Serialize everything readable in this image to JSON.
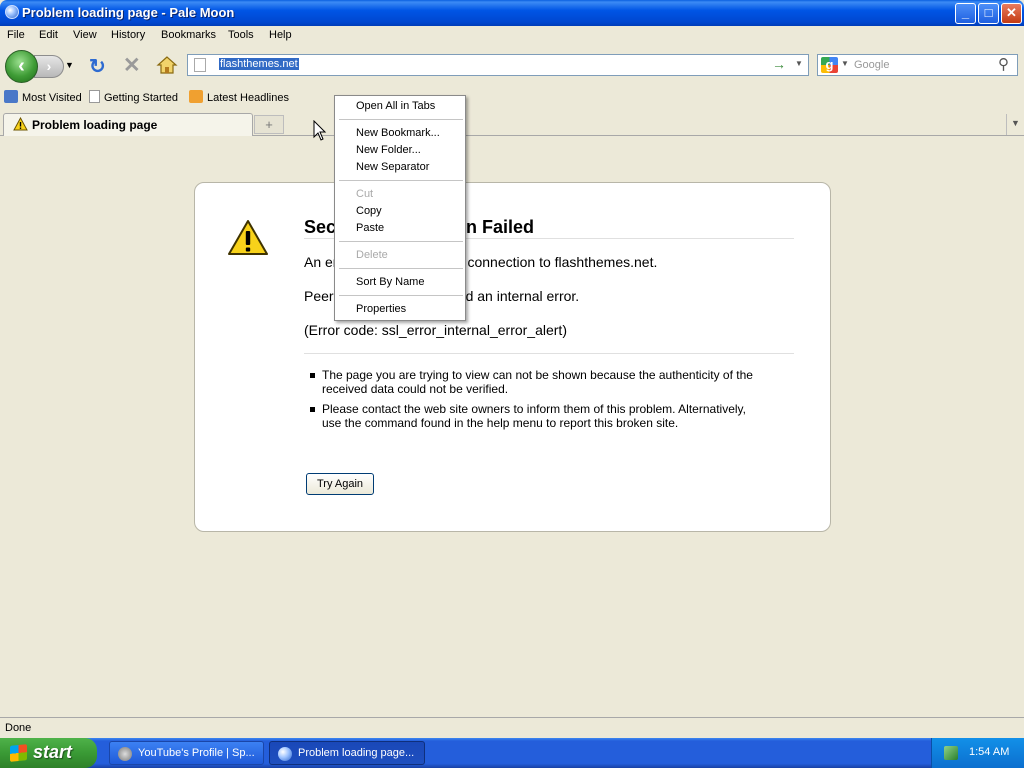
{
  "window": {
    "title": "Problem loading page - Pale Moon",
    "controls": {
      "minimize": "_",
      "maximize": "□",
      "close": "✕"
    }
  },
  "menubar": {
    "items": [
      "File",
      "Edit",
      "View",
      "History",
      "Bookmarks",
      "Tools",
      "Help"
    ]
  },
  "navbar": {
    "url": "flashthemes.net",
    "search_placeholder": "Google"
  },
  "bookmarks": {
    "items": [
      "Most Visited",
      "Getting Started",
      "Latest Headlines"
    ]
  },
  "tabs": {
    "active": "Problem loading page",
    "newtab_symbol": "+"
  },
  "error_page": {
    "heading_visible_left": "Sec",
    "heading_visible_right": "n Failed",
    "line1_left": "An er",
    "line1_right": "connection to flashthemes.net.",
    "line2_left": "Peer",
    "line2_right": "d an internal error.",
    "error_code": "(Error code: ssl_error_internal_error_alert)",
    "bullets": [
      "The page you are trying to view can not be shown because the authenticity of the received data could not be verified.",
      "Please contact the web site owners to inform them of this problem. Alternatively, use the command found in the help menu to report this broken site."
    ],
    "try_again": "Try Again"
  },
  "context_menu": {
    "items": [
      {
        "label": "Open All in Tabs",
        "disabled": false
      },
      {
        "label": "New Bookmark...",
        "disabled": false
      },
      {
        "label": "New Folder...",
        "disabled": false
      },
      {
        "label": "New Separator",
        "disabled": false
      },
      {
        "label": "Cut",
        "disabled": true
      },
      {
        "label": "Copy",
        "disabled": false
      },
      {
        "label": "Paste",
        "disabled": false
      },
      {
        "label": "Delete",
        "disabled": true
      },
      {
        "label": "Sort By Name",
        "disabled": false
      },
      {
        "label": "Properties",
        "disabled": false
      }
    ]
  },
  "statusbar": {
    "text": "Done"
  },
  "taskbar": {
    "start_label": "start",
    "tasks": [
      "YouTube's Profile | Sp...",
      "Problem loading page..."
    ],
    "clock": "1:54 AM"
  },
  "colors": {
    "titlebar": "#0055E5",
    "selection": "#316AC5",
    "taskbar": "#245EDB",
    "start_button": "#3A9A35",
    "window_bg": "#ECE9D8"
  }
}
